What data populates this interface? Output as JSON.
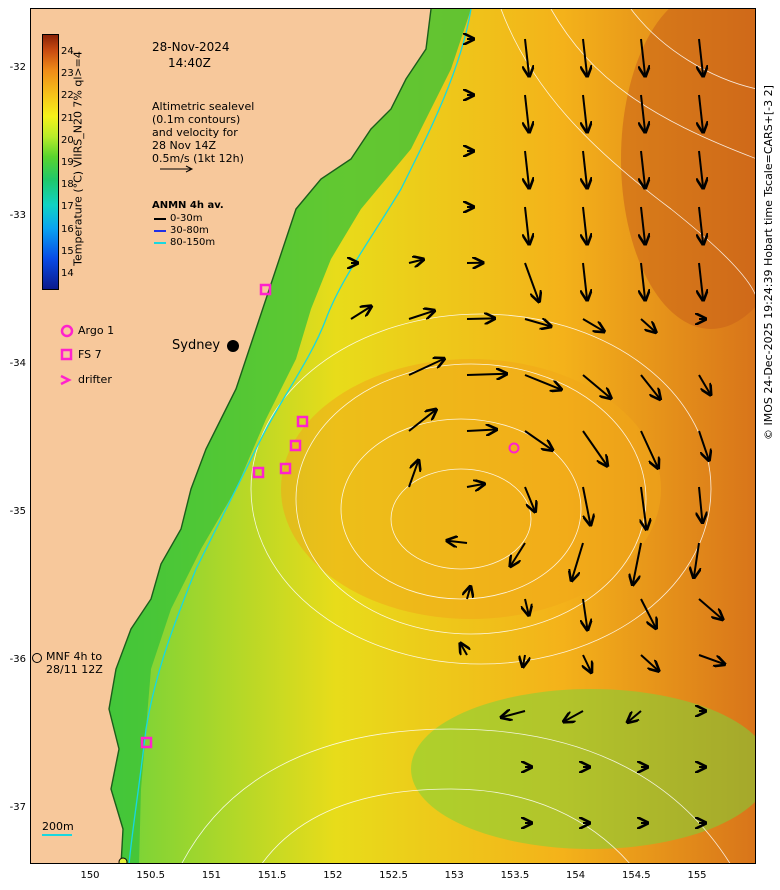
{
  "header": {
    "date": "28-Nov-2024",
    "time": "14:40Z"
  },
  "notes": {
    "altimetry": [
      "Altimetric sealevel",
      "(0.1m contours)",
      "and velocity for",
      "28 Nov 14Z",
      "0.5m/s (1kt 12h)"
    ],
    "anmn_title": "ANMN 4h av.",
    "anmn_items": [
      {
        "label": "0-30m",
        "color": "#000000"
      },
      {
        "label": "30-80m",
        "color": "#1f2fe6"
      },
      {
        "label": "80-150m",
        "color": "#18d8e0"
      }
    ]
  },
  "colorbar": {
    "label": "Temperature (°C) VIIRS_N20 7% ql>=4",
    "ticks": [
      "24",
      "23",
      "22",
      "21",
      "20",
      "19",
      "18",
      "17",
      "16",
      "15",
      "14"
    ]
  },
  "legend": {
    "argo": "Argo 1",
    "fs": "FS 7",
    "drifter": "drifter",
    "mnf": [
      "MNF 4h to",
      "28/11 12Z"
    ],
    "isobath": "200m",
    "colors": {
      "argo": "#ff22cc",
      "fs": "#ff22cc",
      "drifter": "#ff22cc",
      "isobath": "#18d8e0"
    }
  },
  "place": {
    "sydney": "Sydney"
  },
  "axes": {
    "y_ticks": [
      "-32",
      "-33",
      "-34",
      "-35",
      "-36",
      "-37"
    ],
    "x_ticks": [
      "150",
      "150.5",
      "151",
      "151.5",
      "152",
      "152.5",
      "153",
      "153.5",
      "154",
      "154.5",
      "155"
    ]
  },
  "credit": "© IMOS 24-Dec-2025 19:24:39 Hobart time Tscale=CARS+[-3 2]"
}
